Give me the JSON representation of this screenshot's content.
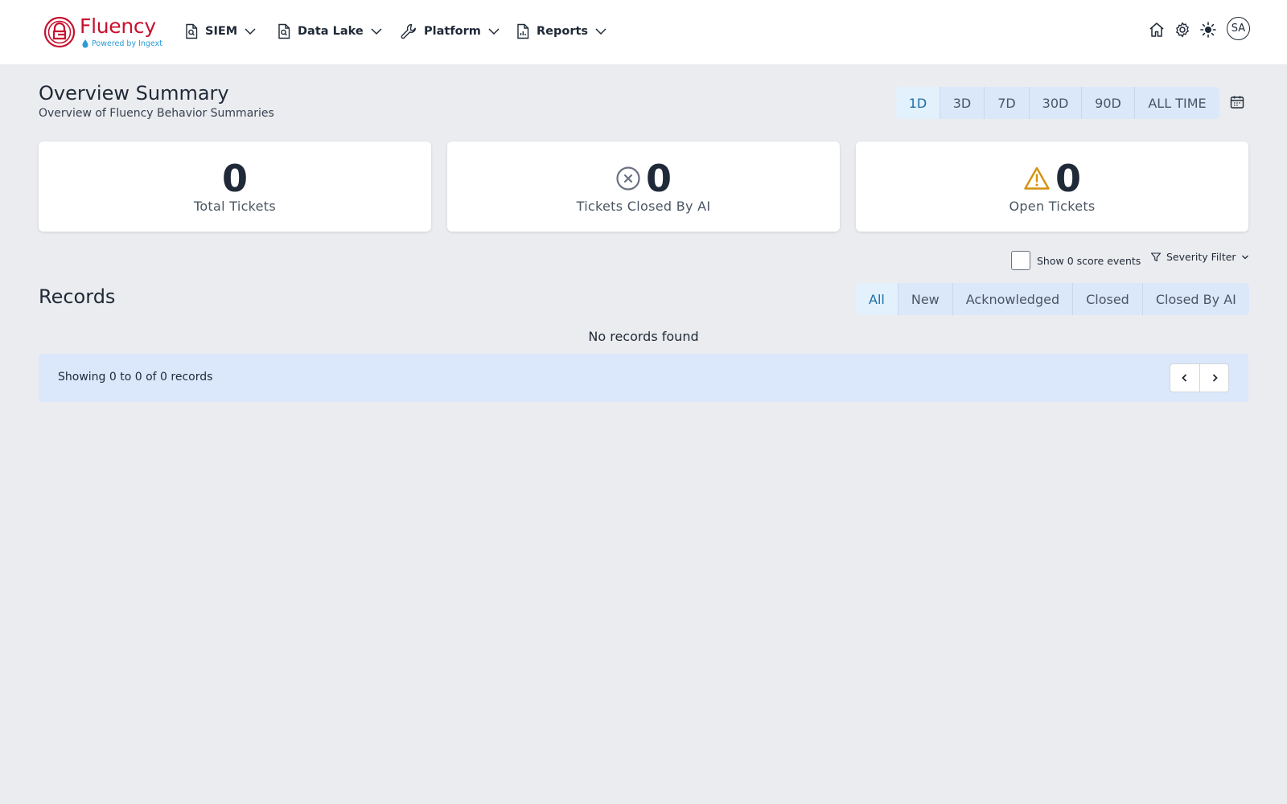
{
  "brand": {
    "name": "Fluency",
    "tagline": "Powered by Ingext",
    "logo_color": "#c8102e",
    "tagline_color": "#2a9bd8"
  },
  "nav": {
    "items": [
      {
        "label": "SIEM",
        "icon": "search-document-icon"
      },
      {
        "label": "Data Lake",
        "icon": "search-document-icon"
      },
      {
        "label": "Platform",
        "icon": "wrench-icon"
      },
      {
        "label": "Reports",
        "icon": "chart-document-icon"
      }
    ],
    "right_icons": [
      "home-icon",
      "gear-icon",
      "sun-icon"
    ],
    "avatar_initials": "SA"
  },
  "header": {
    "title": "Overview Summary",
    "subtitle": "Overview of Fluency Behavior Summaries"
  },
  "time_ranges": {
    "options": [
      "1D",
      "3D",
      "7D",
      "30D",
      "90D",
      "ALL TIME"
    ],
    "selected": "1D",
    "calendar_icon": "calendar-icon"
  },
  "stats": [
    {
      "value": "0",
      "label": "Total Tickets",
      "icon": ""
    },
    {
      "value": "0",
      "label": "Tickets Closed By AI",
      "icon": "x-circle-icon"
    },
    {
      "value": "0",
      "label": "Open Tickets",
      "icon": "warning-triangle-icon"
    }
  ],
  "filters": {
    "show_score_events_label": "Show 0 score events",
    "show_score_events_checked": false,
    "severity_filter_label": "Severity Filter"
  },
  "records": {
    "title": "Records",
    "status_tabs": [
      "All",
      "New",
      "Acknowledged",
      "Closed",
      "Closed By AI"
    ],
    "selected_tab": "All",
    "empty_message": "No records found",
    "pagination_text": "Showing 0 to 0 of 0 records"
  },
  "colors": {
    "page_bg": "#ebecef",
    "accent_active": "#1d6fa6",
    "group_bg": "#dbe8f9",
    "warning": "#d4920f"
  }
}
